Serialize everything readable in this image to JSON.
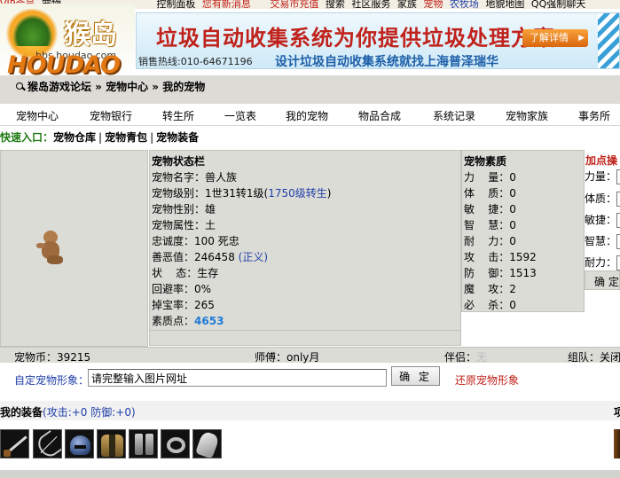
{
  "top_nav": [
    "VIP会员",
    "宠物",
    "宠物",
    "控制面板",
    "您有新消息",
    "交易市充值",
    "搜索",
    "社区服务",
    "家族",
    "宠物",
    "农牧场",
    "地貌地图",
    "QQ强制聊天"
  ],
  "logo": {
    "brand_cn": "猴岛",
    "brand_en": "HOUDAO",
    "url": "bbs.houdao.com"
  },
  "banner": {
    "headline": "垃圾自动收集系统为你提供垃圾处理方案",
    "hotline": "销售热线:010-64671196",
    "slogan": "设计垃圾自动收集系统就找上海普泽瑞华",
    "detail_button": "了解详情"
  },
  "breadcrumb": "猴岛游戏论坛 » 宠物中心 » 我的宠物",
  "menu": [
    "宠物中心",
    "宠物银行",
    "转生所",
    "一览表",
    "我的宠物",
    "物品合成",
    "系统记录",
    "宠物家族",
    "事务所"
  ],
  "quick_links": {
    "label": "快速入口：",
    "links": [
      "宠物仓库",
      "宠物青包",
      "宠物装备"
    ]
  },
  "status": {
    "title": "宠物状态栏",
    "name_label": "宠物名字：",
    "name": "兽人族",
    "level_label": "宠物级别：",
    "level": "1世31转1级(",
    "level_link": "1750级转生",
    "level_end": ")",
    "gender_label": "宠物性别：",
    "gender": "雄",
    "attribute_label": "宠物属性：",
    "attribute": "土",
    "loyalty_label": "忠诚度：",
    "loyalty": "100 死忠",
    "karma_label": "善恶值：",
    "karma": "246458",
    "karma_note": "(正义)",
    "state_label": "状    态：",
    "state": "生存",
    "evasion_label": "回避率：",
    "evasion": "0%",
    "drop_label": "掉宝率：",
    "drop": "265",
    "points_label": "素质点：",
    "points": "4653"
  },
  "qualities": {
    "title": "宠物素质",
    "rows": [
      {
        "label": "力    量：",
        "value": "0"
      },
      {
        "label": "体    质：",
        "value": "0"
      },
      {
        "label": "敏    捷：",
        "value": "0"
      },
      {
        "label": "智    慧：",
        "value": "0"
      },
      {
        "label": "耐    力：",
        "value": "0"
      },
      {
        "label": "攻    击：",
        "value": "1592"
      },
      {
        "label": "防    御：",
        "value": "1513"
      },
      {
        "label": "魔    攻：",
        "value": "2"
      },
      {
        "label": "必    杀：",
        "value": "0"
      }
    ]
  },
  "add_points": {
    "title": "加点操",
    "rows": [
      "力量：",
      "体质：",
      "敏捷：",
      "智慧：",
      "耐力："
    ],
    "confirm": "确 定"
  },
  "money_row": {
    "coins_label": "宠物币：",
    "coins": "39215",
    "master_label": "师傅：",
    "master": "only月",
    "partner_label": "伴侣：",
    "partner": "无",
    "team_label": "组队：",
    "team": "关闭"
  },
  "image_row": {
    "label": "自定宠物形象：",
    "placeholder": "请完整输入图片网址",
    "value": "请完整输入图片网址",
    "confirm": "确 定",
    "restore": "还原宠物形象"
  },
  "equipment": {
    "title": "我的装备",
    "stats": "(攻击:+0 防御:+0)",
    "right_label": "项",
    "items": [
      "sword-icon",
      "bow-icon",
      "helmet-icon",
      "armor-icon",
      "boots-icon",
      "ring-icon",
      "gauntlet-icon"
    ]
  },
  "colors": {
    "accent_red": "#c0221b",
    "link_blue": "#1f3fa8",
    "panel_gray": "#dcdcd7",
    "quick_green": "#1d7a10"
  }
}
